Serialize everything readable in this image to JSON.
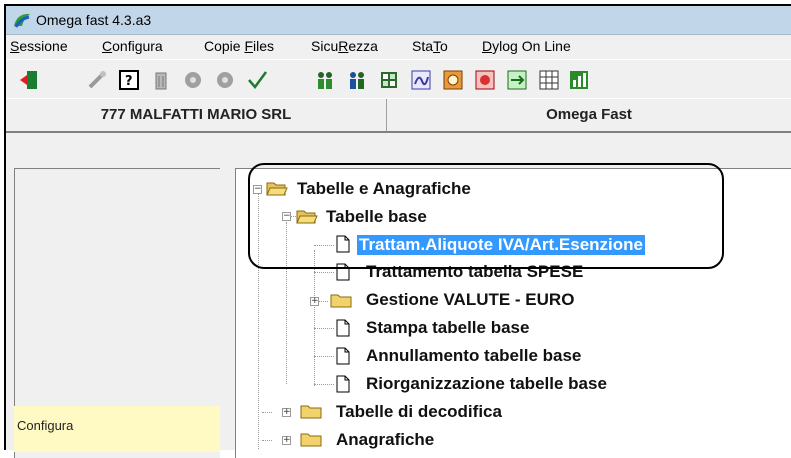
{
  "window": {
    "title": "Omega fast  4.3.a3"
  },
  "menu": [
    {
      "pre": "",
      "u": "S",
      "post": "essione"
    },
    {
      "pre": "",
      "u": "C",
      "post": "onfigura"
    },
    {
      "pre": "Copie ",
      "u": "F",
      "post": "iles"
    },
    {
      "pre": "Sicu",
      "u": "R",
      "post": "ezza"
    },
    {
      "pre": "Sta",
      "u": "T",
      "post": "o"
    },
    {
      "pre": "",
      "u": "D",
      "post": "ylog On Line"
    }
  ],
  "header": {
    "company": "777 MALFATTI MARIO SRL",
    "app": "Omega Fast"
  },
  "left": {
    "configura": "Configura"
  },
  "tree": [
    {
      "label": "Tabelle e Anagrafiche"
    },
    {
      "label": "Tabelle base"
    },
    {
      "label": "Trattam.Aliquote IVA/Art.Esenzione"
    },
    {
      "label": "Trattamento tabella SPESE"
    },
    {
      "label": "Gestione  VALUTE - EURO"
    },
    {
      "label": "Stampa tabelle base"
    },
    {
      "label": "Annullamento tabelle base"
    },
    {
      "label": "Riorganizzazione tabelle base"
    },
    {
      "label": "Tabelle di decodifica"
    },
    {
      "label": "Anagrafiche"
    }
  ],
  "toolbar": [
    "exit-icon",
    "tools-icon",
    "help-icon",
    "trash-icon",
    "gear-icon",
    "gear-icon",
    "checkmark-icon",
    "people-icon",
    "person-pair-icon",
    "calculator-icon",
    "signature-icon",
    "money-icon",
    "money-alert-icon",
    "money-transfer-icon",
    "table-icon",
    "chart-icon"
  ]
}
